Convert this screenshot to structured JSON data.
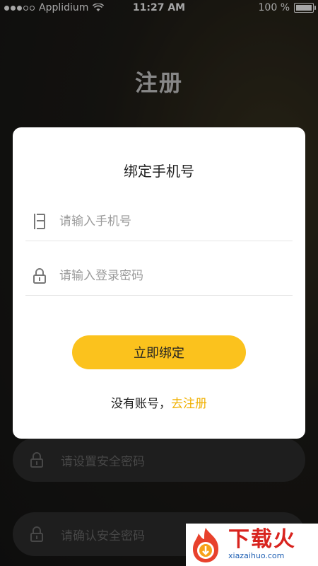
{
  "status_bar": {
    "carrier": "Applidium",
    "time": "11:27 AM",
    "battery": "100 %"
  },
  "page": {
    "title": "注册"
  },
  "background_fields": {
    "set_password_placeholder": "请设置安全密码",
    "confirm_password_placeholder": "请确认安全密码"
  },
  "modal": {
    "title": "绑定手机号",
    "phone_placeholder": "请输入手机号",
    "password_placeholder": "请输入登录密码",
    "bind_button": "立即绑定",
    "no_account_text": "没有账号，",
    "register_link": "去注册"
  },
  "watermark": {
    "brand_cn": "下载火",
    "brand_en": "xiazaihuo.com"
  },
  "colors": {
    "accent": "#fbc21d",
    "link": "#f0b000",
    "watermark_red": "#d8231e",
    "watermark_blue": "#1e5fb3"
  },
  "icons": [
    "phone-icon",
    "lock-icon",
    "wifi-icon",
    "battery-icon",
    "signal-icon",
    "flame-logo-icon"
  ]
}
